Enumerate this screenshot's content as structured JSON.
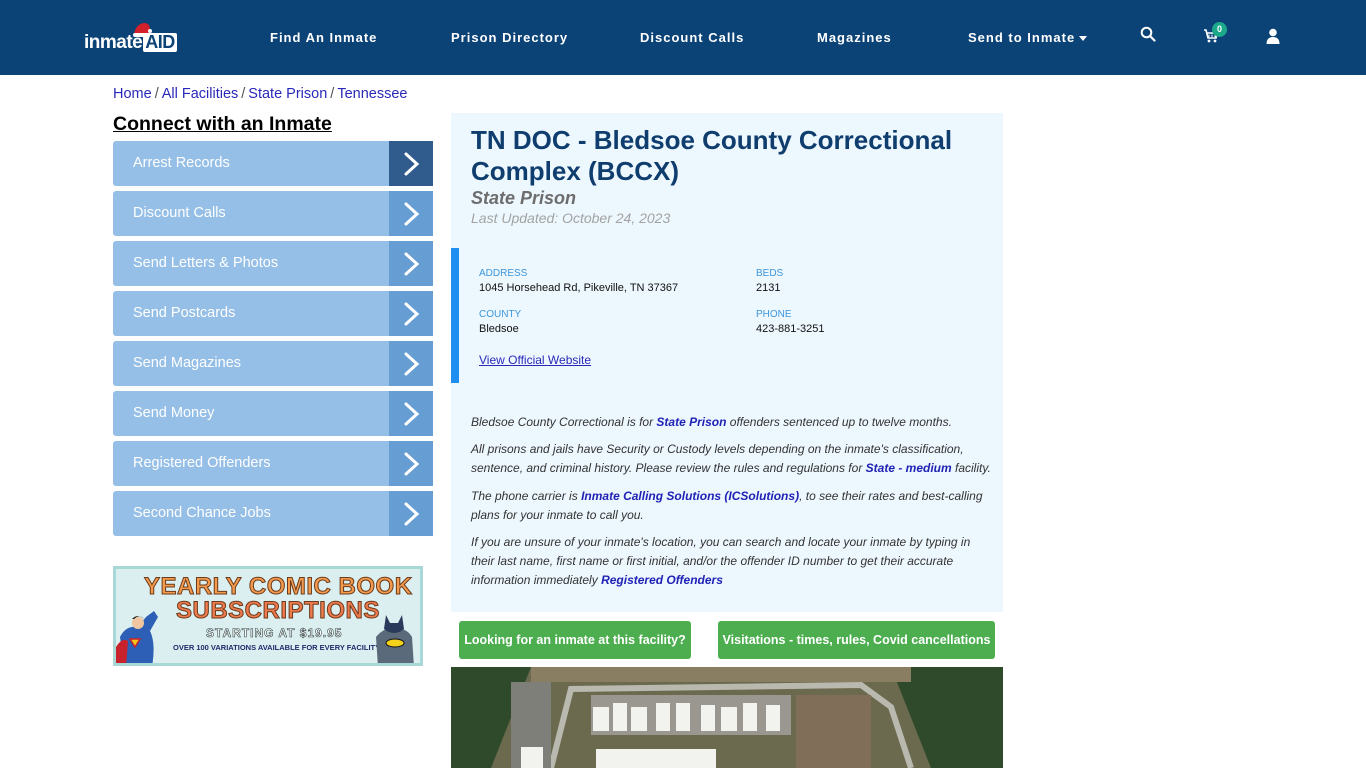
{
  "header": {
    "logo_text": "inmate",
    "logo_accent": "AID",
    "nav": [
      {
        "label": "Find An Inmate"
      },
      {
        "label": "Prison Directory"
      },
      {
        "label": "Discount Calls"
      },
      {
        "label": "Magazines"
      },
      {
        "label": "Send to Inmate",
        "has_dropdown": true
      }
    ],
    "icons": {
      "search": "search-icon",
      "cart": "cart-icon",
      "user": "user-icon"
    },
    "cart_count": "0",
    "colors": {
      "bar": "#0c4377",
      "badge": "#1ba98a"
    }
  },
  "breadcrumb": [
    {
      "label": "Home"
    },
    {
      "label": "All Facilities"
    },
    {
      "label": "State Prison"
    },
    {
      "label": "Tennessee"
    }
  ],
  "breadcrumb_separator": "/",
  "sidebar": {
    "title": "Connect with an Inmate",
    "items": [
      {
        "label": "Arrest Records"
      },
      {
        "label": "Discount Calls"
      },
      {
        "label": "Send Letters & Photos"
      },
      {
        "label": "Send Postcards"
      },
      {
        "label": "Send Magazines"
      },
      {
        "label": "Send Money"
      },
      {
        "label": "Registered Offenders"
      },
      {
        "label": "Second Chance Jobs"
      }
    ],
    "ad": {
      "line1": "YEARLY COMIC BOOK",
      "line2": "SUBSCRIPTIONS",
      "line3": "STARTING AT $19.95",
      "line4": "OVER 100 VARIATIONS AVAILABLE FOR EVERY FACILITY"
    }
  },
  "facility": {
    "title": "TN DOC - Bledsoe County Correctional Complex (BCCX)",
    "type": "State Prison",
    "last_updated": "Last Updated: October 24, 2023",
    "address_label": "ADDRESS",
    "address": "1045 Horsehead Rd, Pikeville, TN 37367",
    "beds_label": "BEDS",
    "beds": "2131",
    "county_label": "COUNTY",
    "county": "Bledsoe",
    "phone_label": "PHONE",
    "phone": "423-881-3251",
    "website_link": "View Official Website"
  },
  "description": {
    "p1_pre": "Bledsoe County Correctional is for ",
    "p1_link": "State Prison",
    "p1_post": " offenders sentenced up to twelve months.",
    "p2_pre": "All prisons and jails have Security or Custody levels depending on the inmate's classification, sentence, and criminal history. Please review the rules and regulations for ",
    "p2_link": "State - medium",
    "p2_post": " facility.",
    "p3_pre": "The phone carrier is ",
    "p3_link": "Inmate Calling Solutions (ICSolutions)",
    "p3_post": ", to see their rates and best-calling plans for your inmate to call you.",
    "p4_pre": "If you are unsure of your inmate's location, you can search and locate your inmate by typing in their last name, first name or first initial, and/or the offender ID number to get their accurate information immediately ",
    "p4_link": "Registered Offenders"
  },
  "buttons": {
    "find_inmate": "Looking for an inmate at this facility?",
    "visitations": "Visitations - times, rules, Covid cancellations"
  }
}
